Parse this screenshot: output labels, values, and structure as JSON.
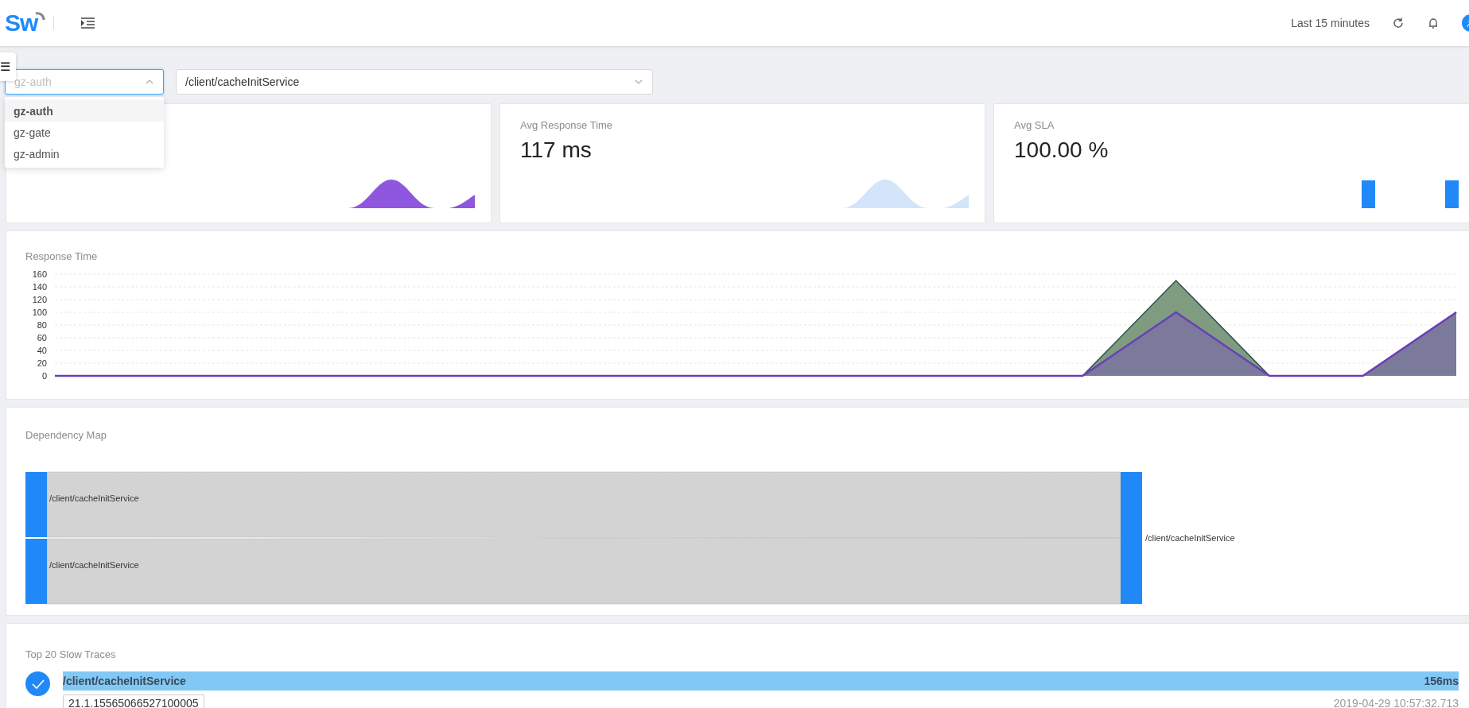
{
  "header": {
    "logo": "Sw",
    "time_range": "Last 15 minutes"
  },
  "side_toggle": "☰",
  "service_select": {
    "value": "gz-auth",
    "expanded": true,
    "options": [
      {
        "label": "gz-auth",
        "selected": true
      },
      {
        "label": "gz-gate",
        "selected": false
      },
      {
        "label": "gz-admin",
        "selected": false
      }
    ]
  },
  "endpoint_select": {
    "value": "/client/cacheInitService",
    "expanded": false
  },
  "metric_cards": [
    {
      "kind": "area",
      "color": "#8f57dd"
    },
    {
      "kind": "area",
      "title": "Avg Response Time",
      "value": "117 ms",
      "color": "#d2e5fb"
    },
    {
      "kind": "bar",
      "title": "Avg SLA",
      "value": "100.00 %",
      "color": "#2189f7"
    }
  ],
  "response_time": {
    "title": "Response Time",
    "chart_data": {
      "type": "area",
      "grid": true,
      "ylim": [
        0,
        160
      ],
      "yticks": [
        0,
        20,
        40,
        60,
        80,
        100,
        120,
        140,
        160
      ],
      "series": [
        {
          "color": "#7f9c80",
          "values": [
            0,
            0,
            0,
            0,
            0,
            0,
            0,
            0,
            0,
            0,
            0,
            0,
            150,
            0,
            0,
            100
          ]
        },
        {
          "color": "#7b7a9a",
          "values": [
            0,
            0,
            0,
            0,
            0,
            0,
            0,
            0,
            0,
            0,
            0,
            0,
            100,
            0,
            0,
            100
          ]
        }
      ]
    }
  },
  "dependency_map": {
    "title": "Dependency Map",
    "sources": [
      "/client/cacheInitService",
      "/client/cacheInitService"
    ],
    "target": "/client/cacheInitService"
  },
  "slow_traces": {
    "title": "Top 20 Slow Traces",
    "items": [
      {
        "endpoint": "/client/cacheInitService",
        "duration": "156ms",
        "trace_id": "21.1.15565066527100005",
        "time": "2019-04-29 10:57:32.713"
      }
    ]
  }
}
